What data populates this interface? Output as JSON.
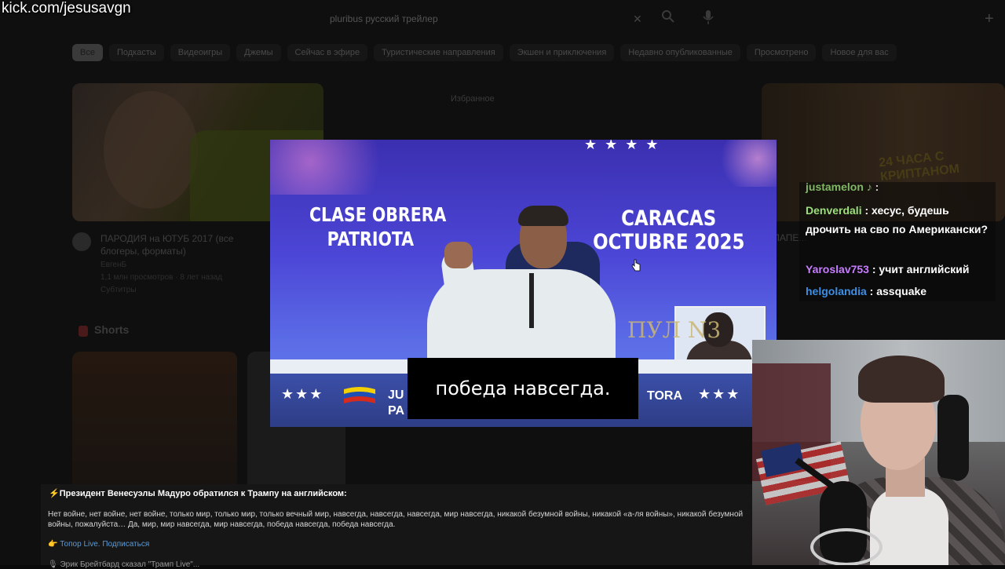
{
  "stream_url": "kick.com/jesusavgn",
  "background_page": {
    "search_query": "pluribus русский трейлер",
    "chips": [
      "Все",
      "Подкасты",
      "Видеоигры",
      "Джемы",
      "Сейчас в эфире",
      "Туристические направления",
      "Экшен и приключения",
      "Недавно опубликованные",
      "Просмотрено",
      "Новое для вас"
    ],
    "video_title": "ПАРОДИЯ на ЮТУБ 2017 (все блогеры, форматы)",
    "video_channel": "ЕвгенБ",
    "video_meta": "1,1 млн просмотров · 8 лет назад",
    "video_tag": "Субтитры",
    "shorts_label": "Shorts",
    "mid_card_title": "Избранное",
    "right_thumb_text": "24 ЧАСА С КРИПТАНОМ",
    "right_title": "ЛАПЕ..."
  },
  "video": {
    "left_banner": [
      "CLASE OBRERA",
      "PATRIOTA"
    ],
    "right_banner": [
      "CARACAS",
      "OCTUBRE 2025"
    ],
    "bottom_left_text": [
      "JU",
      "PA"
    ],
    "bottom_right_text": "TORA",
    "watermark": "ПУЛ N3",
    "subtitle": "победа навсегда."
  },
  "chat": [
    {
      "user": "justamelon ♪",
      "text": " : ",
      "color": "#9be07a"
    },
    {
      "user": "Denverdali",
      "text": " : хесус, будешь дрочить на сво по Американски?",
      "color": "#9be07a"
    },
    {
      "user": "Yaroslav753",
      "text": " : учит английский",
      "color": "#c77dff"
    },
    {
      "user": "helgolandia",
      "text": " : assquake",
      "color": "#3d8fe6"
    }
  ],
  "post": {
    "title": "⚡Президент Венесуэлы Мадуро обратился к Трампу на английском:",
    "body": "Нет войне, нет войне, нет войне, только мир, только мир, только вечный мир, навсегда, навсегда, навсегда, мир навсегда, никакой безумной войны, никакой «а-ля войны», никакой безумной войны, пожалуйста… Да, мир, мир навсегда, мир навсегда, победа навсегда, победа навсегда.",
    "link_prefix": "👉",
    "link_text": "Топор Live. Подписаться",
    "cut_line": "🎙 Эрик Брейтбард сказал \"Трамп Live\"..."
  },
  "colors": {
    "video_bg": "#4c46d6",
    "subtitle_bg": "#000000",
    "link": "#5a9ad8"
  }
}
